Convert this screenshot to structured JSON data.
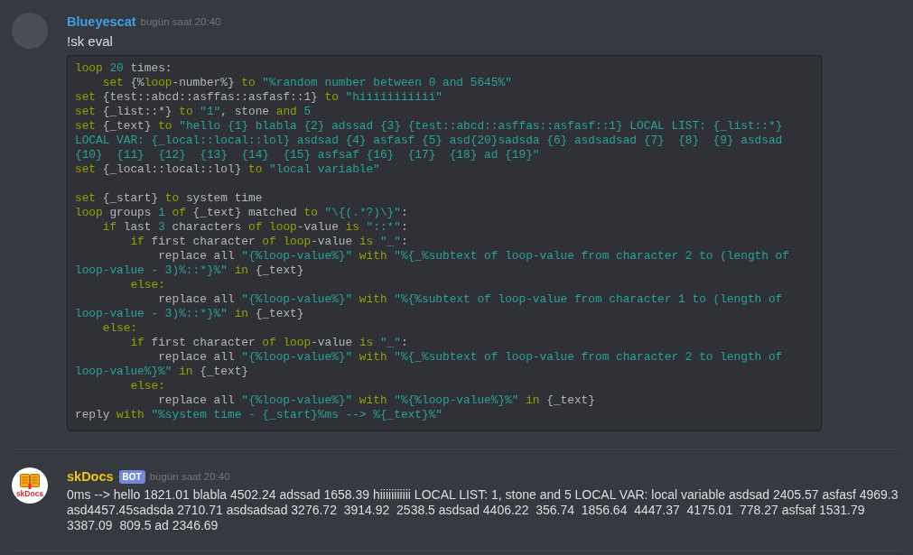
{
  "messages": [
    {
      "avatar": {
        "kind": "photo"
      },
      "author": "Blueyescat",
      "color": "#3ea0e6",
      "timestamp": "bugün saat 20:40",
      "text": "!sk eval",
      "code": {
        "sections": [
          {
            "lines": [
              {
                "tokens": [
                  {
                    "kind": "keyword",
                    "text": "loop"
                  },
                  {
                    "kind": "number",
                    "text": " 20"
                  },
                  {
                    "kind": "plain",
                    "text": " times:"
                  }
                ],
                "children": [
                  {
                    "tokens": [
                      {
                        "kind": "keyword",
                        "text": "set"
                      },
                      {
                        "kind": "plain",
                        "text": " {%"
                      },
                      {
                        "kind": "keyword",
                        "text": "loop"
                      },
                      {
                        "kind": "plain",
                        "text": "-number%} "
                      },
                      {
                        "kind": "keyword",
                        "text": "to"
                      },
                      {
                        "kind": "string",
                        "text": " \"%random number between 0 and 5645%\""
                      }
                    ]
                  }
                ]
              },
              {
                "tokens": [
                  {
                    "kind": "keyword",
                    "text": "set"
                  },
                  {
                    "kind": "plain",
                    "text": " {test::abcd::asffas::asfasf::1} "
                  },
                  {
                    "kind": "keyword",
                    "text": "to"
                  },
                  {
                    "kind": "string",
                    "text": " \"hiiiiiiiiiii\""
                  }
                ]
              },
              {
                "tokens": [
                  {
                    "kind": "keyword",
                    "text": "set"
                  },
                  {
                    "kind": "plain",
                    "text": " {_list::*} "
                  },
                  {
                    "kind": "keyword",
                    "text": "to"
                  },
                  {
                    "kind": "string",
                    "text": " \"1\""
                  },
                  {
                    "kind": "plain",
                    "text": ", stone "
                  },
                  {
                    "kind": "keyword",
                    "text": "and"
                  },
                  {
                    "kind": "number",
                    "text": " 5"
                  }
                ]
              },
              {
                "tokens": [
                  {
                    "kind": "keyword",
                    "text": "set"
                  },
                  {
                    "kind": "plain",
                    "text": " {_text} "
                  },
                  {
                    "kind": "keyword",
                    "text": "to"
                  },
                  {
                    "kind": "string",
                    "text": " \"hello {1} blabla {2} adssad {3} {test::abcd::asffas::asfasf::1} LOCAL LIST: {_list::*}"
                  }
                ],
                "wrapped": [
                  {
                    "tokens": [
                      {
                        "kind": "string",
                        "text": "LOCAL VAR: {_local::local::lol} asdsad {4} asfasf {5} asd{20}sadsda {6} asdsadsad {7}  {8}  {9} asdsad"
                      }
                    ]
                  },
                  {
                    "tokens": [
                      {
                        "kind": "string",
                        "text": "{10}  {11}  {12}  {13}  {14}  {15} asfsaf {16}  {17}  {18} ad {19}\""
                      }
                    ]
                  }
                ]
              },
              {
                "tokens": [
                  {
                    "kind": "keyword",
                    "text": "set"
                  },
                  {
                    "kind": "plain",
                    "text": " {_local::local::lol} "
                  },
                  {
                    "kind": "keyword",
                    "text": "to"
                  },
                  {
                    "kind": "string",
                    "text": " \"local variable\""
                  }
                ]
              }
            ]
          },
          {
            "lines": [
              {
                "tokens": [
                  {
                    "kind": "keyword",
                    "text": "set"
                  },
                  {
                    "kind": "plain",
                    "text": " {_start} "
                  },
                  {
                    "kind": "keyword",
                    "text": "to"
                  },
                  {
                    "kind": "plain",
                    "text": " system time"
                  }
                ]
              },
              {
                "tokens": [
                  {
                    "kind": "keyword",
                    "text": "loop"
                  },
                  {
                    "kind": "plain",
                    "text": " groups "
                  },
                  {
                    "kind": "number",
                    "text": "1"
                  },
                  {
                    "kind": "keyword",
                    "text": " of"
                  },
                  {
                    "kind": "plain",
                    "text": " {_text} matched "
                  },
                  {
                    "kind": "keyword",
                    "text": "to"
                  },
                  {
                    "kind": "string",
                    "text": " \"\\{(.*?)\\}\""
                  },
                  {
                    "kind": "plain",
                    "text": ":"
                  }
                ],
                "children": [
                  {
                    "tokens": [
                      {
                        "kind": "keyword",
                        "text": "if"
                      },
                      {
                        "kind": "plain",
                        "text": " last "
                      },
                      {
                        "kind": "number",
                        "text": "3"
                      },
                      {
                        "kind": "plain",
                        "text": " characters "
                      },
                      {
                        "kind": "keyword",
                        "text": "of"
                      },
                      {
                        "kind": "keyword",
                        "text": " loop"
                      },
                      {
                        "kind": "plain",
                        "text": "-value "
                      },
                      {
                        "kind": "keyword",
                        "text": "is"
                      },
                      {
                        "kind": "string",
                        "text": " \"::*\""
                      },
                      {
                        "kind": "plain",
                        "text": ":"
                      }
                    ],
                    "children": [
                      {
                        "tokens": [
                          {
                            "kind": "keyword",
                            "text": "if"
                          },
                          {
                            "kind": "plain",
                            "text": " first character "
                          },
                          {
                            "kind": "keyword",
                            "text": "of"
                          },
                          {
                            "kind": "keyword",
                            "text": " loop"
                          },
                          {
                            "kind": "plain",
                            "text": "-value "
                          },
                          {
                            "kind": "keyword",
                            "text": "is"
                          },
                          {
                            "kind": "string",
                            "text": " \"_\""
                          },
                          {
                            "kind": "plain",
                            "text": ":"
                          }
                        ],
                        "children": [
                          {
                            "tokens": [
                              {
                                "kind": "plain",
                                "text": "replace all "
                              },
                              {
                                "kind": "string",
                                "text": "\"{%loop-value%}\""
                              },
                              {
                                "kind": "keyword",
                                "text": " with"
                              },
                              {
                                "kind": "string",
                                "text": " \"%{_%subtext of loop-value from character 2 to (length of"
                              }
                            ],
                            "wrapped": [
                              {
                                "tokens": [
                                  {
                                    "kind": "string",
                                    "text": "loop-value - 3)%::*}%\""
                                  },
                                  {
                                    "kind": "keyword",
                                    "text": " in"
                                  },
                                  {
                                    "kind": "plain",
                                    "text": " {_text}"
                                  }
                                ]
                              }
                            ]
                          }
                        ]
                      },
                      {
                        "tokens": [
                          {
                            "kind": "keyword",
                            "text": "else:"
                          }
                        ],
                        "children": [
                          {
                            "tokens": [
                              {
                                "kind": "plain",
                                "text": "replace all "
                              },
                              {
                                "kind": "string",
                                "text": "\"{%loop-value%}\""
                              },
                              {
                                "kind": "keyword",
                                "text": " with"
                              },
                              {
                                "kind": "string",
                                "text": " \"%{%subtext of loop-value from character 1 to (length of"
                              }
                            ],
                            "wrapped": [
                              {
                                "tokens": [
                                  {
                                    "kind": "string",
                                    "text": "loop-value - 3)%::*}%\""
                                  },
                                  {
                                    "kind": "keyword",
                                    "text": " in"
                                  },
                                  {
                                    "kind": "plain",
                                    "text": " {_text}"
                                  }
                                ]
                              }
                            ]
                          }
                        ]
                      }
                    ]
                  },
                  {
                    "tokens": [
                      {
                        "kind": "keyword",
                        "text": "else:"
                      }
                    ],
                    "children": [
                      {
                        "tokens": [
                          {
                            "kind": "keyword",
                            "text": "if"
                          },
                          {
                            "kind": "plain",
                            "text": " first character "
                          },
                          {
                            "kind": "keyword",
                            "text": "of"
                          },
                          {
                            "kind": "keyword",
                            "text": " loop"
                          },
                          {
                            "kind": "plain",
                            "text": "-value "
                          },
                          {
                            "kind": "keyword",
                            "text": "is"
                          },
                          {
                            "kind": "string",
                            "text": " \"_\""
                          },
                          {
                            "kind": "plain",
                            "text": ":"
                          }
                        ],
                        "children": [
                          {
                            "tokens": [
                              {
                                "kind": "plain",
                                "text": "replace all "
                              },
                              {
                                "kind": "string",
                                "text": "\"{%loop-value%}\""
                              },
                              {
                                "kind": "keyword",
                                "text": " with"
                              },
                              {
                                "kind": "string",
                                "text": " \"%{_%subtext of loop-value from character 2 to length of"
                              }
                            ],
                            "wrapped": [
                              {
                                "tokens": [
                                  {
                                    "kind": "string",
                                    "text": "loop-value%}%\""
                                  },
                                  {
                                    "kind": "keyword",
                                    "text": " in"
                                  },
                                  {
                                    "kind": "plain",
                                    "text": " {_text}"
                                  }
                                ]
                              }
                            ]
                          }
                        ]
                      },
                      {
                        "tokens": [
                          {
                            "kind": "keyword",
                            "text": "else:"
                          }
                        ],
                        "children": [
                          {
                            "tokens": [
                              {
                                "kind": "plain",
                                "text": "replace all "
                              },
                              {
                                "kind": "string",
                                "text": "\"{%loop-value%}\""
                              },
                              {
                                "kind": "keyword",
                                "text": " with"
                              },
                              {
                                "kind": "string",
                                "text": " \"%{%loop-value%}%\""
                              },
                              {
                                "kind": "keyword",
                                "text": " in"
                              },
                              {
                                "kind": "plain",
                                "text": " {_text}"
                              }
                            ]
                          }
                        ]
                      }
                    ]
                  }
                ]
              },
              {
                "tokens": [
                  {
                    "kind": "plain",
                    "text": "reply "
                  },
                  {
                    "kind": "keyword",
                    "text": "with"
                  },
                  {
                    "kind": "string",
                    "text": " \"%system time - {_start}%ms --> %{_text}%\""
                  }
                ]
              }
            ]
          }
        ]
      }
    },
    {
      "avatar": {
        "kind": "logo",
        "text": "skDocs"
      },
      "author": "skDocs",
      "color": "#f1c40f",
      "badge": "BOT",
      "timestamp": "bugün saat 20:40",
      "text": "0ms --> hello 1821.01 blabla 4502.24 adssad 1658.39 hiiiiiiiiiii LOCAL LIST: 1, stone and 5 LOCAL VAR: local variable asdsad 2405.57 asfasf 4969.3 asd4457.45sadsda 2710.71 asdsadsad 3276.72  3914.92  2538.5 asdsad 4406.22  356.74  1856.64  4447.37  4175.01  778.27 asfsaf 1531.79 3387.09  809.5 ad 2346.69"
    }
  ]
}
